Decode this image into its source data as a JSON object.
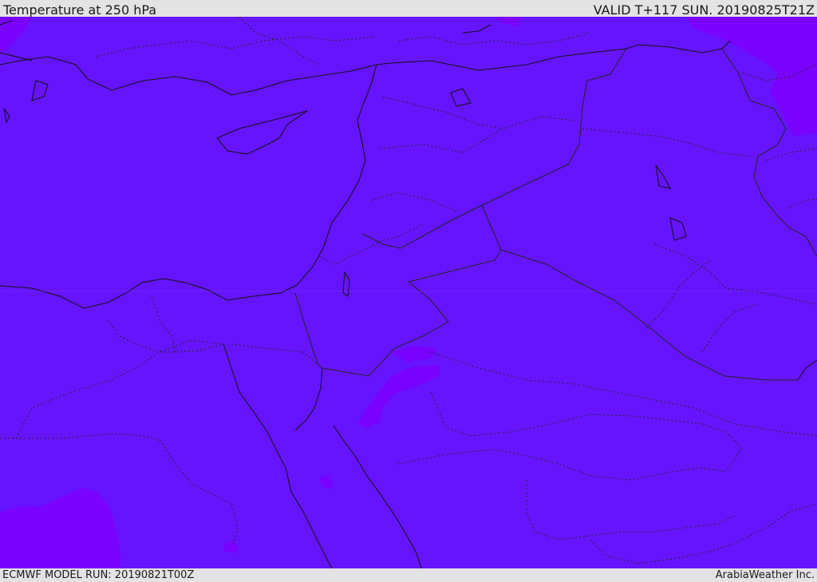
{
  "header": {
    "title": "Temperature at 250 hPa",
    "valid": "VALID T+117 SUN. 20190825T21Z"
  },
  "footer": {
    "model_run": "ECMWF MODEL RUN: 20190821T00Z",
    "credit": "ArabiaWeather Inc."
  },
  "colors": {
    "base_fill": "#6614ff",
    "warm_patch": "#7a00ff",
    "cool_patch": "#8a00ff",
    "coastline": "#111111",
    "border": "#222222"
  }
}
